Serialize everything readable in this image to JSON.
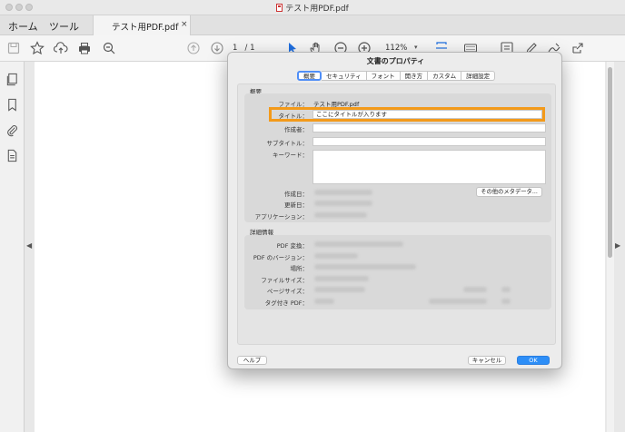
{
  "window": {
    "title": "テスト用PDF.pdf"
  },
  "tabs": {
    "home": "ホーム",
    "tools": "ツール",
    "document": "テスト用PDF.pdf",
    "close_glyph": "×"
  },
  "toolbar": {
    "page_current": "1",
    "page_total": "/ 1",
    "zoom": "112%",
    "icons": [
      "save-icon",
      "star-icon",
      "upload-icon",
      "print-icon",
      "zoom-out-icon",
      "page-up-icon",
      "page-down-icon",
      "select-cursor-icon",
      "hand-icon",
      "zoom-out-icon",
      "zoom-in-icon",
      "fit-page-icon",
      "keyboard-icon",
      "comment-icon",
      "pen-icon",
      "sign-icon",
      "share-icon"
    ]
  },
  "leftrail": {
    "icons": [
      "pages-icon",
      "bookmark-icon",
      "attachment-icon",
      "document-icon"
    ]
  },
  "dialog": {
    "title": "文書のプロパティ",
    "tabs": [
      "概要",
      "セキュリティ",
      "フォント",
      "開き方",
      "カスタム",
      "詳細設定"
    ],
    "active_tab": "概要",
    "summary": {
      "heading": "概要",
      "file_label": "ファイル：",
      "file_value": "テスト用PDF.pdf",
      "title_label": "タイトル：",
      "title_value": "ここにタイトルが入ります",
      "author_label": "作成者：",
      "subject_label": "サブタイトル：",
      "keywords_label": "キーワード：",
      "created_label": "作成日：",
      "modified_label": "更新日：",
      "application_label": "アプリケーション：",
      "more_button": "その他のメタデータ..."
    },
    "advanced": {
      "heading": "詳細情報",
      "producer_label": "PDF 変換：",
      "version_label": "PDF のバージョン：",
      "location_label": "場所：",
      "size_label": "ファイルサイズ：",
      "page_size_label": "ページサイズ：",
      "tagged_label": "タグ付き PDF："
    },
    "buttons": {
      "help": "ヘルプ",
      "cancel": "キャンセル",
      "ok": "OK"
    }
  },
  "colors": {
    "highlight": "#f39a1a",
    "ok_button": "#2d8ef7",
    "active_tab_border": "#4f8ef7"
  }
}
